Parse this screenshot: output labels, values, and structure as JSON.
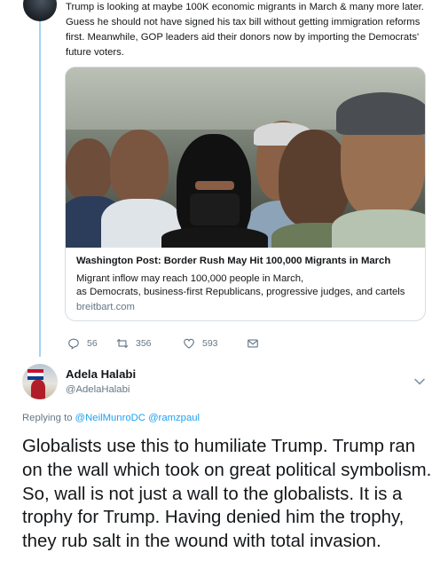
{
  "quoted_tweet": {
    "text": "Trump is looking at maybe 100K economic migrants in March & many more later. Guess he should not have signed his tax bill without getting immigration reforms first. Meanwhile, GOP leaders aid their donors now by importing the Democrats' future voters.",
    "card": {
      "title": "Washington Post: Border Rush May Hit 100,000 Migrants in March",
      "description_line1": "Migrant inflow may reach 100,000 people in March,",
      "description_line2": "as Democrats, business-first Republicans, progressive judges, and cartels",
      "domain": "breitbart.com"
    },
    "actions": {
      "replies": "56",
      "retweets": "356",
      "likes": "593"
    }
  },
  "reply_tweet": {
    "author_name": "Adela Halabi",
    "author_handle": "@AdelaHalabi",
    "replying_label": "Replying to",
    "replying_to": [
      "@NeilMunroDC",
      "@ramzpaul"
    ],
    "text": "Globalists use this to humiliate Trump. Trump ran on the wall which took on great political symbolism. So, wall is not just a wall to the globalists. It is a trophy for Trump. Having denied him the trophy, they rub salt in the wound with total invasion."
  },
  "icons": [
    "reply-icon",
    "retweet-icon",
    "like-icon",
    "message-icon",
    "chevron-down-icon"
  ],
  "colors": {
    "accent": "#1da1f2",
    "thread_line": "#9fd6f7",
    "secondary_text": "#657786",
    "primary_text": "#14171a",
    "border": "#d6dde3"
  }
}
